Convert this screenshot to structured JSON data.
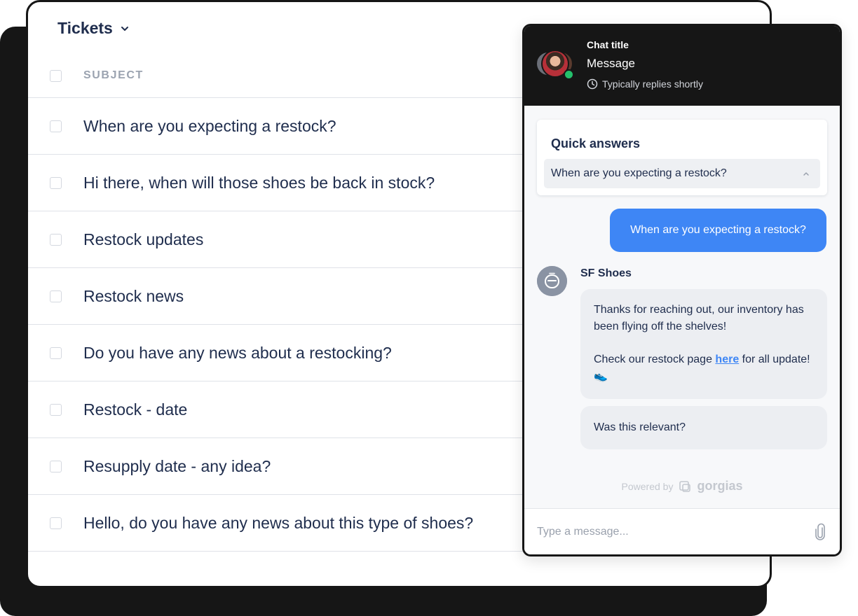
{
  "tickets": {
    "title": "Tickets",
    "column_header": "SUBJECT",
    "rows": [
      "When are you expecting a restock?",
      "Hi there, when will those shoes be back in stock?",
      "Restock updates",
      "Restock news",
      "Do you have any news about a restocking?",
      "Restock - date",
      "Resupply date - any idea?",
      "Hello, do you have any news about this type of shoes?"
    ]
  },
  "chat": {
    "header": {
      "title": "Chat title",
      "message": "Message",
      "reply_time": "Typically replies shortly"
    },
    "quick_answers": {
      "title": "Quick answers",
      "selected": "When are you expecting a restock?"
    },
    "user_message": "When are you expecting a restock?",
    "bot": {
      "name": "SF Shoes",
      "message_part1": "Thanks for reaching out, our inventory has been flying off the shelves!",
      "message_part2_prefix": "Check our restock page ",
      "message_link": "here",
      "message_part2_suffix": " for all update! 👟",
      "followup": "Was this relevant?"
    },
    "powered_by": {
      "label": "Powered by",
      "brand": "gorgias"
    },
    "input": {
      "placeholder": "Type a message..."
    }
  },
  "colors": {
    "ink": "#161616",
    "accent_blue": "#3e86f5",
    "text_primary": "#1f2d4d",
    "muted": "#9ba3b0",
    "online_green": "#24c06b"
  },
  "icons": [
    "chevron-down-icon",
    "clock-icon",
    "chevron-up-icon",
    "bot-avatar-icon",
    "gorgias-logo-icon",
    "paperclip-icon"
  ]
}
